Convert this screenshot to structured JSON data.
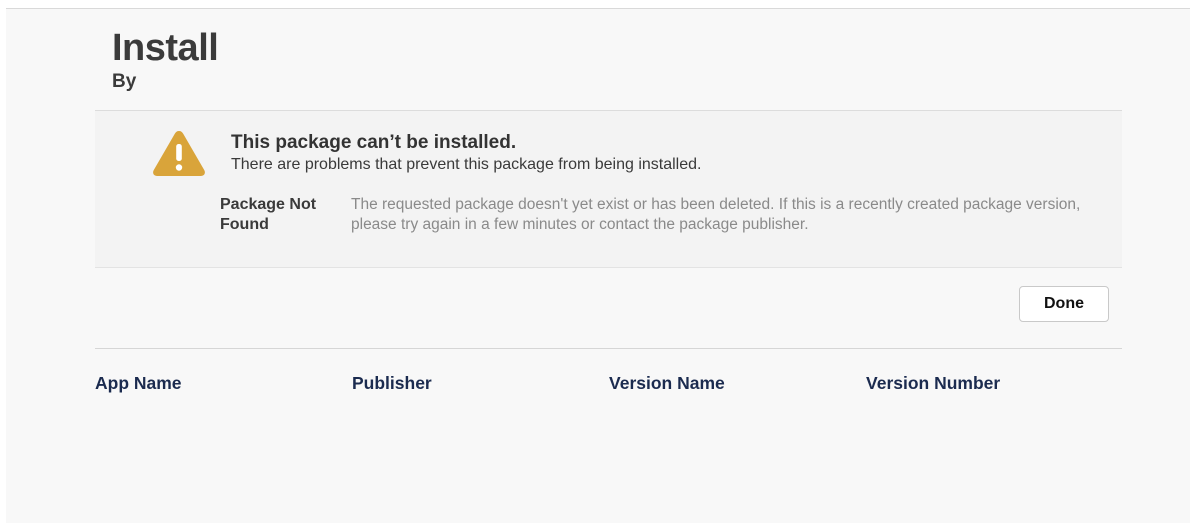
{
  "header": {
    "title": "Install",
    "subtitle": "By"
  },
  "alert": {
    "icon": "warning-icon",
    "icon_color": "#d9a43a",
    "title": "This package can’t be installed.",
    "description": "There are problems that prevent this package from being installed.",
    "error_label": "Package Not Found",
    "error_message": "The requested package doesn't yet exist or has been deleted. If this is a recently created package version, please try again in a few minutes or contact the package publisher."
  },
  "actions": {
    "done_label": "Done"
  },
  "table": {
    "columns": [
      "App Name",
      "Publisher",
      "Version Name",
      "Version Number"
    ],
    "header_color": "#1b2b4f"
  }
}
